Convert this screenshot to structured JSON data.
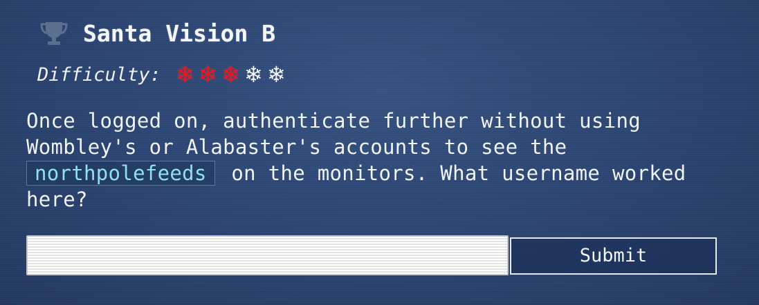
{
  "objective": {
    "title": "Santa Vision B",
    "trophy_icon": "trophy-icon",
    "difficulty": {
      "label": "Difficulty:",
      "level": 3,
      "max": 5,
      "on_color": "#e8131b",
      "off_color": "#f5f7fa"
    },
    "question": {
      "part1": "Once logged on, authenticate further without using Wombley's or Alabaster's accounts to see the ",
      "code": "northpolefeeds",
      "part2": " on the monitors. What username worked here?"
    }
  },
  "answer_form": {
    "input_value": "",
    "submit_label": "Submit"
  }
}
